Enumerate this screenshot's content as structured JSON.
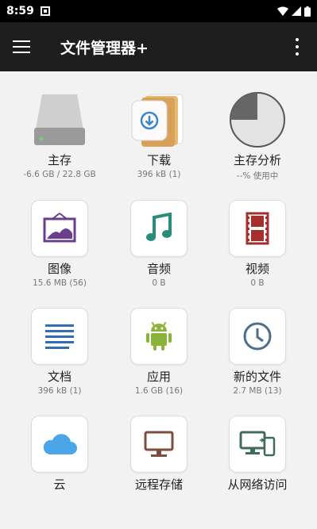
{
  "status_bar": {
    "time": "8:59"
  },
  "app_bar": {
    "title": "文件管理器+"
  },
  "items": [
    {
      "label": "主存",
      "sub": "-6.6 GB / 22.8 GB"
    },
    {
      "label": "下载",
      "sub": "396 kB (1)"
    },
    {
      "label": "主存分析",
      "sub": "--% 使用中"
    },
    {
      "label": "图像",
      "sub": "15.6 MB (56)"
    },
    {
      "label": "音频",
      "sub": "0 B"
    },
    {
      "label": "视频",
      "sub": "0 B"
    },
    {
      "label": "文档",
      "sub": "396 kB (1)"
    },
    {
      "label": "应用",
      "sub": "1.6 GB (16)"
    },
    {
      "label": "新的文件",
      "sub": "2.7 MB (13)"
    },
    {
      "label": "云",
      "sub": ""
    },
    {
      "label": "远程存储",
      "sub": ""
    },
    {
      "label": "从网络访问",
      "sub": ""
    }
  ],
  "colors": {
    "image": "#6a3d8f",
    "audio": "#2a8c7a",
    "video": "#a52f2f",
    "document": "#2f6fb5",
    "app": "#8bb33a",
    "recent": "#4b6e8a",
    "cloud": "#4aa6e6",
    "remote": "#7a4e3a",
    "network": "#3f6b5b"
  }
}
